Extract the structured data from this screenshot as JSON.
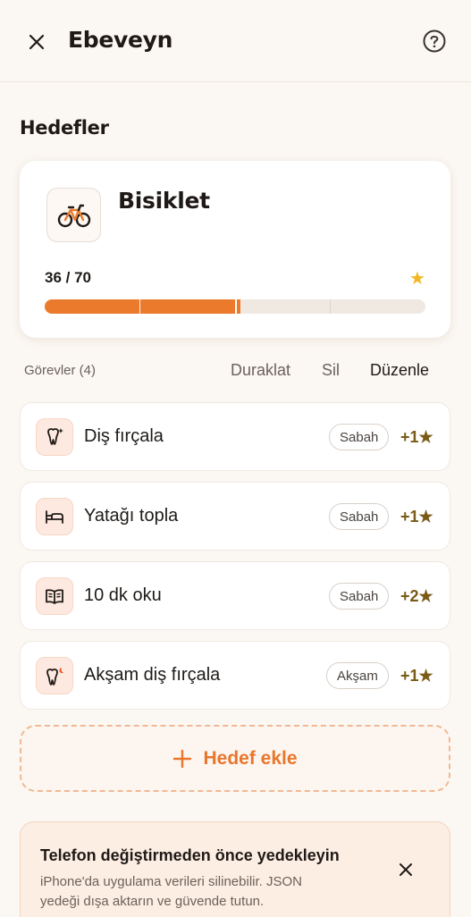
{
  "header": {
    "title": "Ebeveyn",
    "close_icon": "close-icon",
    "help_icon": "help-circle-icon"
  },
  "goals": {
    "section_title": "Hedefler",
    "card": {
      "icon": "bicycle-icon",
      "title": "Bisiklet",
      "progress_text": "36 / 70",
      "current": 36,
      "target": 70,
      "star": "★",
      "accent_color": "#ec7a2c"
    }
  },
  "tasks": {
    "label": "Görevler (4)",
    "actions": {
      "pause": "Duraklat",
      "delete": "Sil",
      "edit": "Düzenle"
    },
    "items": [
      {
        "icon": "tooth-sparkle-icon",
        "label": "Diş fırçala",
        "time": "Sabah",
        "reward": "+1★"
      },
      {
        "icon": "bed-icon",
        "label": "Yatağı topla",
        "time": "Sabah",
        "reward": "+1★"
      },
      {
        "icon": "book-icon",
        "label": "10 dk oku",
        "time": "Sabah",
        "reward": "+2★"
      },
      {
        "icon": "tooth-moon-icon",
        "label": "Akşam diş fırçala",
        "time": "Akşam",
        "reward": "+1★"
      }
    ]
  },
  "add_goal": {
    "icon": "plus-icon",
    "label": "Hedef ekle"
  },
  "backup": {
    "title": "Telefon değiştirmeden önce yedekleyin",
    "body": "iPhone'da uygulama verileri silinebilir. JSON yedeği dışa aktarın ve güvende tutun.",
    "close_icon": "close-icon"
  }
}
